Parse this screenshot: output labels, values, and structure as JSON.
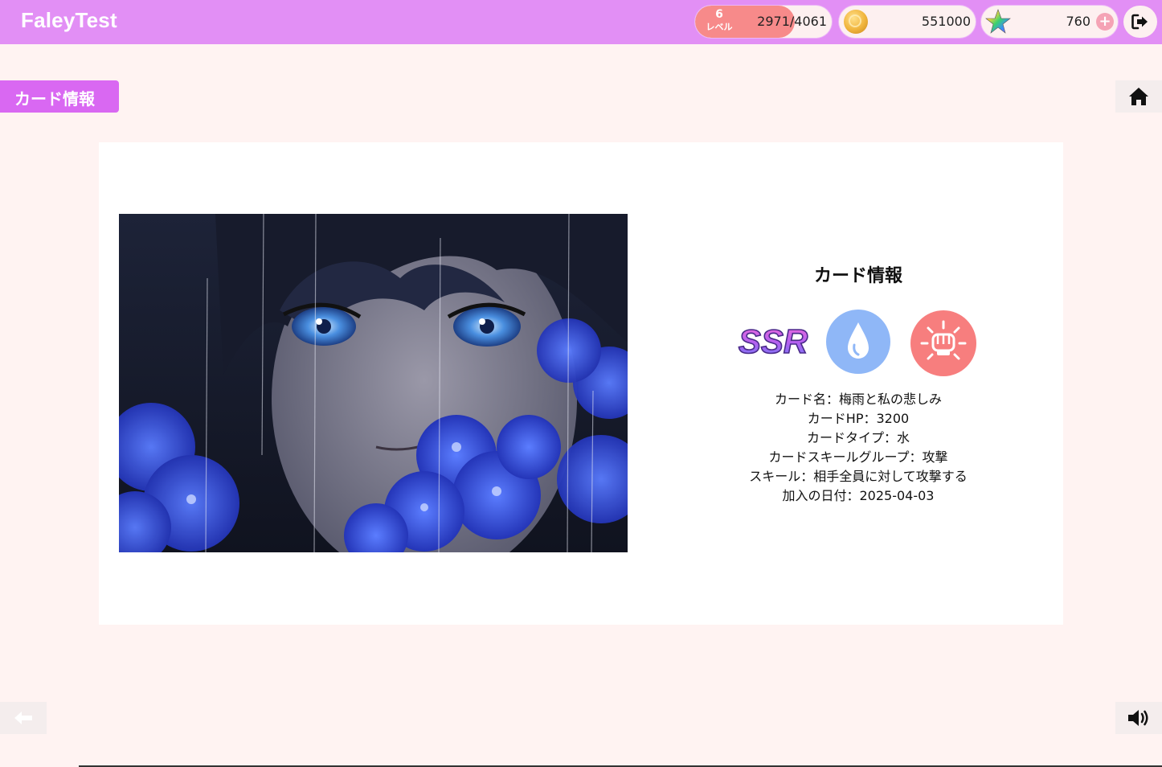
{
  "app": {
    "title": "FaleyTest"
  },
  "header": {
    "level": {
      "number": "6",
      "label": "レベル",
      "xp": "2971/4061",
      "progress": 0.73
    },
    "coins": {
      "value": "551000",
      "icon": "gold-coin-icon"
    },
    "gems": {
      "value": "760",
      "icon": "rainbow-star-icon",
      "add_label": "+"
    },
    "logout": {
      "icon": "logout-icon"
    }
  },
  "page": {
    "tab_label": "カード情報"
  },
  "nav": {
    "home_icon": "home-icon",
    "back_icon": "arrow-left-icon",
    "sound_icon": "speaker-icon"
  },
  "card": {
    "title": "カード情報",
    "rarity": "SSR",
    "element_icon": "water-drop-icon",
    "skill_icon": "fist-attack-icon",
    "stats": [
      "カード名：梅雨と私の悲しみ",
      "カードHP：3200",
      "カードタイプ：水",
      "カードスキールグループ：攻撃",
      "スキール：相手全員に対して攻撃する",
      "加入の日付：2025-04-03"
    ]
  },
  "colors": {
    "header_bg": "#e28ff5",
    "page_bg": "#fff3f2",
    "tab_bg": "#d968f2",
    "level_fill": "#f78a8a",
    "water": "#8fb7f7",
    "attack": "#f77e7e"
  }
}
